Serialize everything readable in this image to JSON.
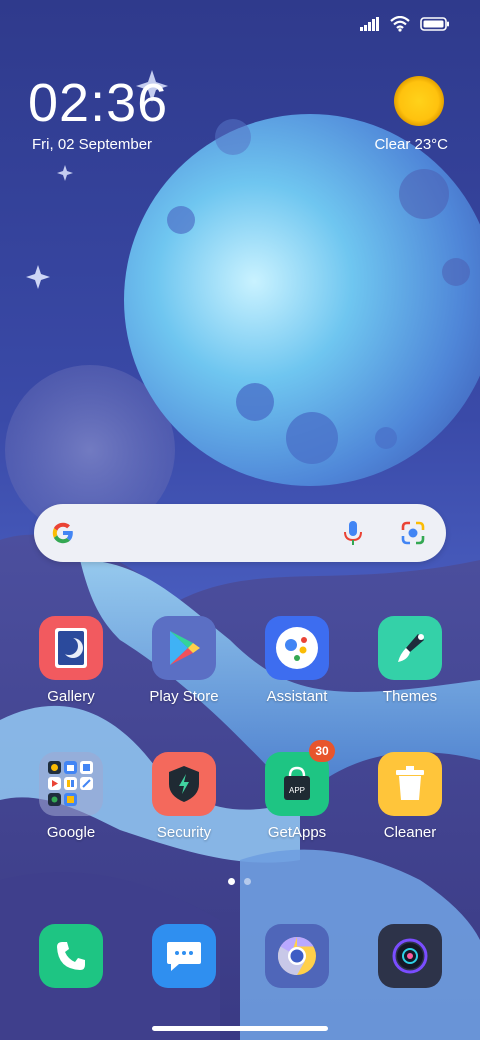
{
  "clock": {
    "time": "02:36",
    "date": "Fri, 02 September"
  },
  "weather": {
    "text": "Clear  23°C",
    "icon": "sun-icon"
  },
  "search": {
    "icons": [
      "google-logo-icon",
      "mic-icon",
      "google-lens-icon"
    ]
  },
  "apps": [
    {
      "label": "Gallery",
      "icon": "gallery-icon",
      "color": "#f25a5f"
    },
    {
      "label": "Play Store",
      "icon": "play-store-icon",
      "color": "#5b6fc4"
    },
    {
      "label": "Assistant",
      "icon": "assistant-icon",
      "color": "#3d6df0"
    },
    {
      "label": "Themes",
      "icon": "themes-brush-icon",
      "color": "#34d1a8"
    },
    {
      "label": "Google",
      "icon": "folder-icon",
      "color": "#8a8fb7"
    },
    {
      "label": "Security",
      "icon": "shield-icon",
      "color": "#f4695c"
    },
    {
      "label": "GetApps",
      "icon": "shopping-bag-icon",
      "color": "#1ec583",
      "badge": "30"
    },
    {
      "label": "Cleaner",
      "icon": "trash-icon",
      "color": "#ffc53a"
    }
  ],
  "dock": [
    {
      "icon": "phone-icon",
      "color": "#1ec583"
    },
    {
      "icon": "messages-icon",
      "color": "#2f8ff0"
    },
    {
      "icon": "chrome-icon",
      "color": "#4f66b9"
    },
    {
      "icon": "camera-icon",
      "color": "#2d3349"
    }
  ],
  "page_indicator": {
    "pages": 2,
    "current": 1
  }
}
